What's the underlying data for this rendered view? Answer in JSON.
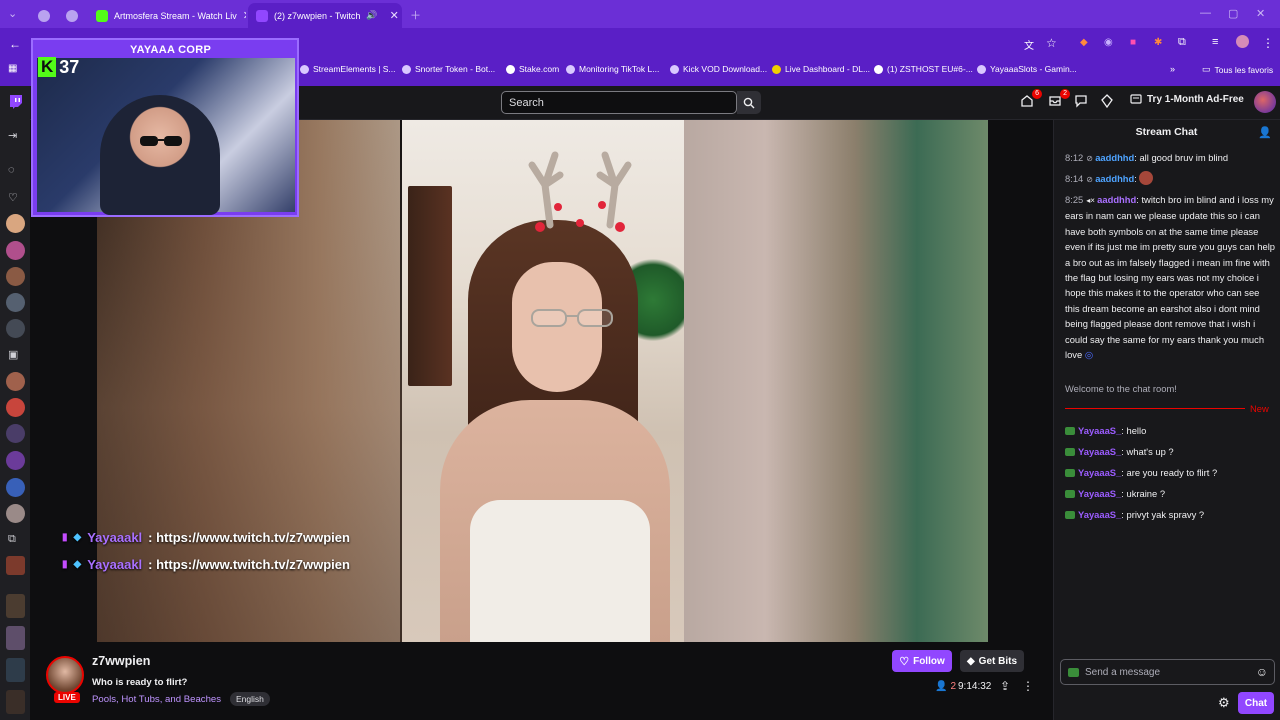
{
  "browser": {
    "tabs": [
      {
        "label": "Artmosfera Stream - Watch Liv"
      },
      {
        "label": "(2) z7wwpien - Twitch"
      }
    ],
    "bookmarks": [
      "StreamElements | S...",
      "Snorter Token - Bot...",
      "Stake.com",
      "Monitoring TikTok L...",
      "Kick VOD Download...",
      "Live Dashboard - DL...",
      "(1) ZSTHOST EU#6-...",
      "YayaaaSlots - Gamin...",
      "Tous les favoris"
    ]
  },
  "twitch": {
    "search_placeholder": "Search",
    "notif_count": "6",
    "inbox_count": "2",
    "adfree_label": "Try 1-Month Ad-Free"
  },
  "webcam": {
    "badge_number": "37",
    "title": "YAYAAA CORP",
    "k_letter": "K"
  },
  "overlay_chat": [
    {
      "name": "Yayaaakl",
      "text": ": https://www.twitch.tv/z7wwpien"
    },
    {
      "name": "Yayaaakl",
      "text": ": https://www.twitch.tv/z7wwpien"
    }
  ],
  "chat": {
    "title": "Stream Chat",
    "messages": [
      {
        "time": "8:12",
        "name": "aaddhhd",
        "text": ": all good bruv im blind"
      },
      {
        "time": "8:14",
        "name": "aaddhhd",
        "text": ":"
      },
      {
        "time": "8:25",
        "name": "aaddhhd",
        "text": ": twitch bro im blind and i loss my ears in nam can we please update this so i can have both symbols on at the same time please even if its just me im pretty sure you guys can help a bro out as im falsely flagged i mean im fine with the flag but losing my ears was not my choice i hope this makes it to the operator who can see this dream become an earshot also i dont mind being flagged please dont remove that i wish i could say the same for my ears thank you much love"
      }
    ],
    "welcome": "Welcome to the chat room!",
    "new_label": "New",
    "recent": [
      {
        "name": "YayaaaS_",
        "text": ": hello"
      },
      {
        "name": "YayaaaS_",
        "text": ": what's up ?"
      },
      {
        "name": "YayaaaS_",
        "text": ": are you ready to flirt ?"
      },
      {
        "name": "YayaaaS_",
        "text": ": ukraine ?"
      },
      {
        "name": "YayaaaS_",
        "text": ": privyt yak spravy ?"
      }
    ],
    "send_placeholder": "Send a message",
    "chat_button": "Chat"
  },
  "stream": {
    "live_label": "LIVE",
    "streamer": "z7wwpien",
    "title": "Who is ready to flirt?",
    "category": "Pools, Hot Tubs, and Beaches",
    "language": "English",
    "follow_label": "Follow",
    "bits_label": "Get Bits",
    "viewers": "2",
    "uptime": "9:14:32"
  },
  "colors": {
    "browser_purple": "#6b2fd6",
    "twitch_purple": "#9147ff",
    "live_red": "#eb0400",
    "kick_green": "#53fc18"
  }
}
